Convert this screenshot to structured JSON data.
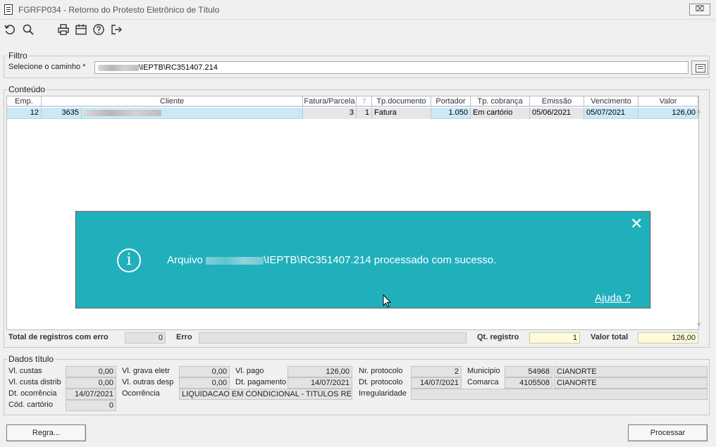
{
  "window": {
    "title": "FGRFP034 - Retorno do Protesto Eletrônico de Título",
    "close_glyph": "⌧"
  },
  "toolbar": {
    "icons": [
      "refresh-icon",
      "search-icon",
      "print-icon",
      "calendar-icon",
      "help-icon",
      "exit-icon"
    ]
  },
  "filtro": {
    "legend": "Filtro",
    "path_label": "Selecione o caminho *",
    "path_value_suffix": "\\IEPTB\\RC351407.214"
  },
  "conteudo": {
    "legend": "Conteúdo",
    "columns": [
      "Emp.",
      "Cliente",
      "Fatura/Parcela",
      "′/",
      "Tp.documento",
      "Portador",
      "Tp. cobrança",
      "Emissão",
      "Vencimento",
      "Valor"
    ],
    "rows": [
      {
        "emp": "12",
        "cliente_cod": "3635",
        "fatura": "3",
        "parcela": "1",
        "tp_documento": "Fatura",
        "portador": "1.050",
        "tp_cobranca": "Em cartório",
        "emissao": "05/06/2021",
        "vencimento": "05/07/2021",
        "valor": "126,00"
      }
    ],
    "scroll_up": "˄",
    "scroll_down": "˅",
    "total_erro_label": "Total de registros com erro",
    "total_erro_value": "0",
    "erro_label": "Erro",
    "erro_value": "",
    "qt_registro_label": "Qt. registro",
    "qt_registro_value": "1",
    "valor_total_label": "Valor total",
    "valor_total_value": "126,00"
  },
  "dados": {
    "legend": "Dados título",
    "vl_custas_label": "Vl. custas",
    "vl_custas": "0,00",
    "vl_custa_distrib_label": "Vl. custa distrib",
    "vl_custa_distrib": "0,00",
    "dt_ocorrencia_label": "Dt. ocorrência",
    "dt_ocorrencia": "14/07/2021",
    "cod_cartorio_label": "Cód. cartório",
    "cod_cartorio": "0",
    "vl_grava_eletr_label": "Vl. grava eletr",
    "vl_grava_eletr": "0,00",
    "vl_outras_desp_label": "Vl. outras desp",
    "vl_outras_desp": "0,00",
    "ocorrencia_label": "Ocorrência",
    "ocorrencia": "LIQUIDACAO EM CONDICIONAL - TITULOS RECEB",
    "vl_pago_label": "Vl. pago",
    "vl_pago": "126,00",
    "dt_pagamento_label": "Dt. pagamento",
    "dt_pagamento": "14/07/2021",
    "nr_protocolo_label": "Nr. protocolo",
    "nr_protocolo": "2",
    "dt_protocolo_label": "Dt. protocolo",
    "dt_protocolo": "14/07/2021",
    "irregularidade_label": "Irregularidade",
    "irregularidade": "",
    "municipio_label": "Municipio",
    "municipio_cod": "54968",
    "municipio_nome": "CIANORTE",
    "comarca_label": "Comarca",
    "comarca_cod": "4105508",
    "comarca_nome": "CIANORTE"
  },
  "buttons": {
    "regra": "Regra...",
    "processar": "Processar"
  },
  "toast": {
    "msg_prefix": "Arquivo",
    "msg_suffix": "\\IEPTB\\RC351407.214 processado com sucesso.",
    "help": "Ajuda ?",
    "close_glyph": "✕",
    "info_glyph": "i",
    "color": "#1fb0bc"
  }
}
